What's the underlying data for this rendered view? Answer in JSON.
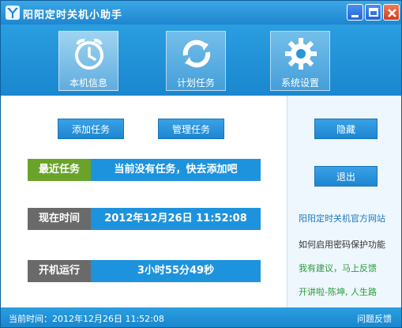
{
  "window": {
    "title": "阳阳定时关机小助手"
  },
  "toolbar": {
    "items": [
      {
        "label": "本机信息",
        "icon": "alarm-clock-icon",
        "active": true
      },
      {
        "label": "计划任务",
        "icon": "refresh-arrows-icon",
        "active": false
      },
      {
        "label": "系统设置",
        "icon": "gear-icon",
        "active": false
      }
    ]
  },
  "main": {
    "add_task_label": "添加任务",
    "manage_task_label": "管理任务",
    "recent_task": {
      "label": "最近任务",
      "value": "当前没有任务，快去添加吧"
    },
    "current_time": {
      "label": "现在时间",
      "value": "2012年12月26日  11:52:08"
    },
    "uptime": {
      "label": "开机运行",
      "value": "3小时55分49秒"
    }
  },
  "side": {
    "hide_label": "隐藏",
    "exit_label": "退出",
    "links": [
      "阳阳定时关机官方网站",
      "如何启用密码保护功能",
      "我有建议，马上反馈",
      "开讲啦-陈坤, 人生路"
    ]
  },
  "status": {
    "time_text": "当前时间：2012年12月26日  11:52:08",
    "feedback_label": "问题反馈"
  },
  "colors": {
    "accent_blue": "#1e93dd",
    "tag_green": "#6aa32a",
    "tag_gray": "#6a6a6a",
    "link_blue": "#1b79c2",
    "link_green": "#2c9a3a"
  }
}
